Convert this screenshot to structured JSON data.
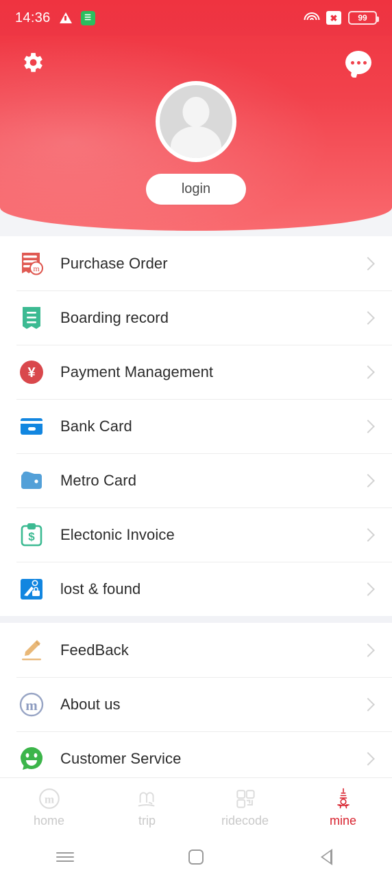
{
  "status_bar": {
    "time": "14:36",
    "warning_icon": "warning-triangle-icon",
    "green_badge_icon": "green-app-badge-icon",
    "wifi_icon": "wifi-icon",
    "sim_icon": "no-sim-x-icon",
    "battery_level": "99"
  },
  "header": {
    "settings_icon": "gear-icon",
    "more_icon": "more-dots-icon",
    "avatar_icon": "default-avatar-icon",
    "login_label": "login",
    "brand_color": "#ef3340"
  },
  "menu": {
    "section_primary": [
      {
        "label": "Purchase Order",
        "icon": "purchase-order-icon"
      },
      {
        "label": "Boarding record",
        "icon": "boarding-record-icon"
      },
      {
        "label": "Payment Management",
        "icon": "yen-payment-icon"
      },
      {
        "label": "Bank Card",
        "icon": "bank-card-icon"
      },
      {
        "label": "Metro Card",
        "icon": "metro-card-wallet-icon"
      },
      {
        "label": "Electonic Invoice",
        "icon": "electronic-invoice-icon"
      },
      {
        "label": "lost & found",
        "icon": "lost-and-found-icon"
      }
    ],
    "section_secondary": [
      {
        "label": "FeedBack",
        "icon": "pencil-feedback-icon"
      },
      {
        "label": "About us",
        "icon": "about-us-logo-icon"
      },
      {
        "label": "Customer Service",
        "icon": "customer-service-headset-icon"
      }
    ],
    "chevron_icon": "chevron-right-icon"
  },
  "tab_bar": {
    "tabs": [
      {
        "label": "home",
        "icon": "home-logo-icon",
        "active": false
      },
      {
        "label": "trip",
        "icon": "trip-icon",
        "active": false
      },
      {
        "label": "ridecode",
        "icon": "ridecode-qr-icon",
        "active": false
      },
      {
        "label": "mine",
        "icon": "mine-tower-icon",
        "active": true
      }
    ],
    "active_color": "#d8232f",
    "inactive_color": "#c9c9c9"
  },
  "system_nav": {
    "menu_icon": "android-menu-icon",
    "home_icon": "android-home-icon",
    "back_icon": "android-back-icon"
  }
}
